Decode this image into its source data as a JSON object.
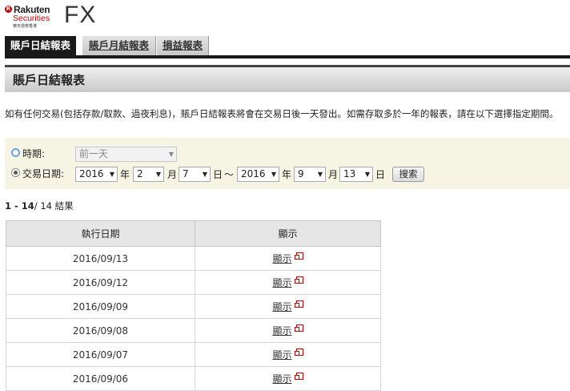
{
  "header": {
    "logo_line1": "Rakuten",
    "logo_line2": "Securities",
    "logo_line3": "樂天證券香港",
    "logo_mark": "R",
    "title": "FX"
  },
  "tabs": [
    {
      "label": "賬戶日結報表",
      "active": true
    },
    {
      "label": "賬戶月結報表",
      "active": false
    },
    {
      "label": "損益報表",
      "active": false
    }
  ],
  "section_title": "賬戶日結報表",
  "intro_text": "如有任何交易(包括存款/取款、過夜利息)，賬戶日結報表將會在交易日後一天發出。如需存取多於一年的報表，請在以下選擇指定期間。",
  "filter": {
    "period_label": "時期:",
    "period_value": "前一天",
    "trade_date_label": "交易日期:",
    "from_year": "2016",
    "from_month": "2",
    "from_day": "7",
    "to_year": "2016",
    "to_month": "9",
    "to_day": "13",
    "unit_year": "年",
    "unit_month": "月",
    "unit_day": "日",
    "tilde": "～",
    "search_label": "搜索",
    "selected": "trade_date"
  },
  "results": {
    "range": "1 - 14",
    "total": "/ 14",
    "suffix": "結果"
  },
  "table": {
    "headers": [
      "執行日期",
      "顯示"
    ],
    "rows": [
      {
        "date": "2016/09/13",
        "link": "顯示"
      },
      {
        "date": "2016/09/12",
        "link": "顯示"
      },
      {
        "date": "2016/09/09",
        "link": "顯示"
      },
      {
        "date": "2016/09/08",
        "link": "顯示"
      },
      {
        "date": "2016/09/07",
        "link": "顯示"
      },
      {
        "date": "2016/09/06",
        "link": "顯示"
      }
    ]
  },
  "colors": {
    "brand_red": "#bf0000",
    "tab_active": "#1a1a1a",
    "filter_bg": "#f6f4e3"
  }
}
